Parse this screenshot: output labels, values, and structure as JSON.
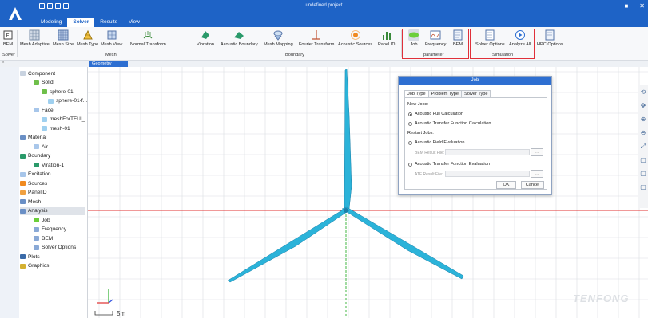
{
  "window": {
    "title": "undefined project",
    "controls": [
      "−",
      "■",
      "✕"
    ]
  },
  "menu_tabs": [
    "Modeling",
    "Solver",
    "Results",
    "View"
  ],
  "ribbon": {
    "groups": {
      "solver": "Solver",
      "mesh": "Mesh",
      "boundary": "Boundary",
      "parameter": "parameter",
      "simulation": "Simulation"
    },
    "buttons": {
      "bem": "BEM",
      "mesh_adaptive": "Mesh Adaptive",
      "mesh_size": "Mesh Size",
      "mesh_type": "Mesh Type",
      "mesh_view": "Mesh View",
      "normal_transform": "Normal Transform",
      "vibration": "Vibration",
      "acoustic_boundary": "Acoustic Boundary",
      "mesh_mapping": "Mesh Mapping",
      "fourier_transform": "Fourier Transform",
      "acoustic_sources": "Acoustic Sources",
      "panel_id": "Panel ID",
      "job": "Job",
      "frequency": "Frequency",
      "bem2": "BEM",
      "solver_options": "Solver Options",
      "analyze_all": "Analyze All",
      "hpc_options": "HPC Options"
    }
  },
  "geometry_tab": "Geometry",
  "tree": [
    {
      "label": "Component",
      "icon": "folder-icon",
      "level": 0
    },
    {
      "label": "Solid",
      "icon": "solid-icon",
      "level": 1
    },
    {
      "label": "sphere-01",
      "icon": "solid-icon",
      "level": 2
    },
    {
      "label": "sphere-01-f...",
      "icon": "sphere-icon",
      "level": 3
    },
    {
      "label": "Face",
      "icon": "face-icon",
      "level": 1
    },
    {
      "label": "meshForTFUI_...",
      "icon": "sphere-icon",
      "level": 2
    },
    {
      "label": "mesh-01",
      "icon": "sphere-icon",
      "level": 2
    },
    {
      "label": "Material",
      "icon": "material-icon",
      "level": 0
    },
    {
      "label": "Air",
      "icon": "air-icon",
      "level": 1
    },
    {
      "label": "Boundary",
      "icon": "boundary-icon",
      "level": 0
    },
    {
      "label": "Viration-1",
      "icon": "vibration-icon",
      "level": 1
    },
    {
      "label": "Excitation",
      "icon": "excitation-icon",
      "level": 0
    },
    {
      "label": "Sources",
      "icon": "sources-icon",
      "level": 0
    },
    {
      "label": "PanelID",
      "icon": "panelid-icon",
      "level": 0
    },
    {
      "label": "Mesh",
      "icon": "mesh-icon",
      "level": 0
    },
    {
      "label": "Analysis",
      "icon": "analysis-icon",
      "level": 0
    },
    {
      "label": "Job",
      "icon": "job-icon",
      "level": 1
    },
    {
      "label": "Frequency",
      "icon": "frequency-icon",
      "level": 1
    },
    {
      "label": "BEM",
      "icon": "bem-icon",
      "level": 1
    },
    {
      "label": "Solver Options",
      "icon": "solver-options-icon",
      "level": 1
    },
    {
      "label": "Plots",
      "icon": "plots-icon",
      "level": 0
    },
    {
      "label": "Graphics",
      "icon": "graphics-icon",
      "level": 0
    }
  ],
  "dialog": {
    "title": "Job",
    "tabs": [
      "Job Type",
      "Problem Type",
      "Solver Type"
    ],
    "new_jobs": "New Jobs:",
    "acoustic_full": "Acoustic Full Calculation",
    "acoustic_transfer": "Acoustic Transfer Function Calculation",
    "restart_jobs": "Restart Jobs:",
    "acoustic_field_eval": "Acoustic Field Evaluation",
    "bem_result_file": "BEM Result File:",
    "acoustic_transfer_eval": "Acoustic Transfer Function Evaluation",
    "atf_result_file": "ATF Result File:",
    "browse": "...",
    "ok": "OK",
    "cancel": "Cancel"
  },
  "viewport": {
    "scale_label": "5m",
    "watermark": "TENFONG"
  },
  "colors": {
    "title_bar": "#1e63c6",
    "accent": "#2e6fd1",
    "highlight_box": "#e0303a",
    "blade": "#2bb3d9"
  }
}
